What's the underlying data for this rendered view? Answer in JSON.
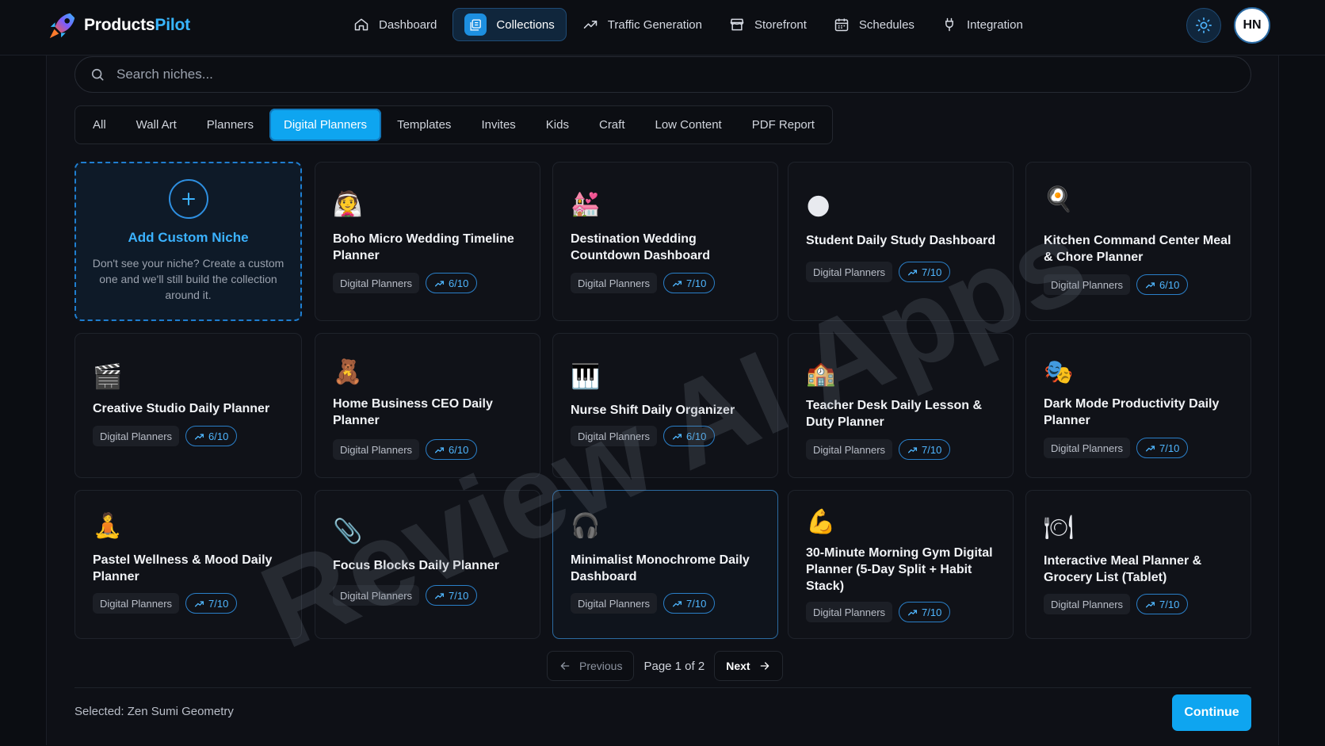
{
  "app": {
    "brand_part1": "Products",
    "brand_part2": "Pilot",
    "avatar_initials": "HN",
    "accent_color": "#0ea5f0"
  },
  "nav": [
    {
      "label": "Dashboard",
      "icon": "home-icon"
    },
    {
      "label": "Collections",
      "icon": "collections-icon",
      "active": true
    },
    {
      "label": "Traffic Generation",
      "icon": "trend-icon"
    },
    {
      "label": "Storefront",
      "icon": "store-icon"
    },
    {
      "label": "Schedules",
      "icon": "calendar-icon"
    },
    {
      "label": "Integration",
      "icon": "plug-icon"
    }
  ],
  "search": {
    "placeholder": "Search niches..."
  },
  "filters": [
    "All",
    "Wall Art",
    "Planners",
    "Digital Planners",
    "Templates",
    "Invites",
    "Kids",
    "Craft",
    "Low Content",
    "PDF Report"
  ],
  "active_filter": "Digital Planners",
  "custom_niche": {
    "title": "Add Custom Niche",
    "description": "Don't see your niche? Create a custom one and we'll still build the collection around it."
  },
  "cards": [
    {
      "emoji": "👰",
      "title": "Boho Micro Wedding Timeline Planner",
      "tag": "Digital Planners",
      "score": "6/10"
    },
    {
      "emoji": "💒",
      "title": "Destination Wedding Countdown Dashboard",
      "tag": "Digital Planners",
      "score": "7/10"
    },
    {
      "emoji": "🌑",
      "title": "Student Daily Study Dashboard",
      "tag": "Digital Planners",
      "score": "7/10"
    },
    {
      "emoji": "🍳",
      "title": "Kitchen Command Center Meal & Chore Planner",
      "tag": "Digital Planners",
      "score": "6/10"
    },
    {
      "emoji": "🎬",
      "title": "Creative Studio Daily Planner",
      "tag": "Digital Planners",
      "score": "6/10"
    },
    {
      "emoji": "🧸",
      "title": "Home Business CEO Daily Planner",
      "tag": "Digital Planners",
      "score": "6/10"
    },
    {
      "emoji": "🎹",
      "title": "Nurse Shift Daily Organizer",
      "tag": "Digital Planners",
      "score": "6/10"
    },
    {
      "emoji": "🏫",
      "title": "Teacher Desk Daily Lesson & Duty Planner",
      "tag": "Digital Planners",
      "score": "7/10"
    },
    {
      "emoji": "🎭",
      "title": "Dark Mode Productivity Daily Planner",
      "tag": "Digital Planners",
      "score": "7/10"
    },
    {
      "emoji": "🧘",
      "title": "Pastel Wellness & Mood Daily Planner",
      "tag": "Digital Planners",
      "score": "7/10"
    },
    {
      "emoji": "📎",
      "title": "Focus Blocks Daily Planner",
      "tag": "Digital Planners",
      "score": "7/10"
    },
    {
      "emoji": "🎧",
      "title": "Minimalist Monochrome Daily Dashboard",
      "tag": "Digital Planners",
      "score": "7/10"
    },
    {
      "emoji": "💪",
      "title": "30-Minute Morning Gym Digital Planner (5-Day Split + Habit Stack)",
      "tag": "Digital Planners",
      "score": "7/10"
    },
    {
      "emoji": "🍽",
      "title": "Interactive Meal Planner & Grocery List (Tablet)",
      "tag": "Digital Planners",
      "score": "7/10"
    }
  ],
  "pagination": {
    "previous": "Previous",
    "label": "Page 1 of 2",
    "next": "Next"
  },
  "footer": {
    "selected": "Selected: Zen Sumi Geometry",
    "continue": "Continue"
  },
  "watermark": "Review AI Apps"
}
